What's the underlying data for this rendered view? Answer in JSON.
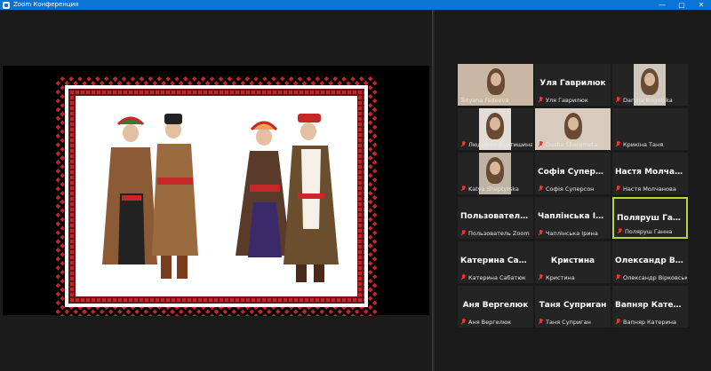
{
  "window": {
    "title": "Zoom Конференция",
    "controls": [
      "—",
      "▢",
      "✕"
    ]
  },
  "participants": [
    {
      "display_name": "",
      "label": "Tetyana Fadeeva",
      "video": true,
      "muted": false
    },
    {
      "display_name": "Уля Гаврилюк",
      "label": "Уля Гаврилюк",
      "video": false,
      "muted": true
    },
    {
      "display_name": "",
      "label": "Daryna Bogotska",
      "video": true,
      "muted": true
    },
    {
      "display_name": "",
      "label": "Людмила Войтишина",
      "video": true,
      "muted": true
    },
    {
      "display_name": "",
      "label": "Dasha Sheremeta",
      "video": true,
      "muted": true
    },
    {
      "display_name": "",
      "label": "Крикіна Таня",
      "video": false,
      "muted": true
    },
    {
      "display_name": "",
      "label": "Katya Sheptytska",
      "video": true,
      "muted": true
    },
    {
      "display_name": "Софія Суперсон",
      "label": "Софія Суперсон",
      "video": false,
      "muted": true
    },
    {
      "display_name": "Настя Молчанова",
      "label": "Настя Молчанова",
      "video": false,
      "muted": true
    },
    {
      "display_name": "Пользователь Zoom",
      "label": "Пользователь Zoom",
      "video": false,
      "muted": true
    },
    {
      "display_name": "Чаплінська Ірина",
      "label": "Чаплінська Ірина",
      "video": false,
      "muted": true
    },
    {
      "display_name": "Поляруш Ганна",
      "label": "Поляруш Ганна",
      "video": false,
      "muted": true,
      "active": true
    },
    {
      "display_name": "Катерина Сабатюк",
      "label": "Катерина Сабатюк",
      "video": false,
      "muted": true
    },
    {
      "display_name": "Кристина",
      "label": "Кристина",
      "video": false,
      "muted": true
    },
    {
      "display_name": "Олександр Вірковський",
      "label": "Олександр Вірковський",
      "video": false,
      "muted": true
    },
    {
      "display_name": "Аня Вергелюк",
      "label": "Аня Вергелюк",
      "video": false,
      "muted": true
    },
    {
      "display_name": "Таня Суприган",
      "label": "Таня Суприган",
      "video": false,
      "muted": true
    },
    {
      "display_name": "Вапняр Катерина",
      "label": "Вапняр Катерина",
      "video": false,
      "muted": true
    }
  ],
  "colors": {
    "titlebar": "#0a73d8",
    "active_speaker": "#b6d53a",
    "muted_mic": "#e33333",
    "tile_bg": "#242424"
  }
}
